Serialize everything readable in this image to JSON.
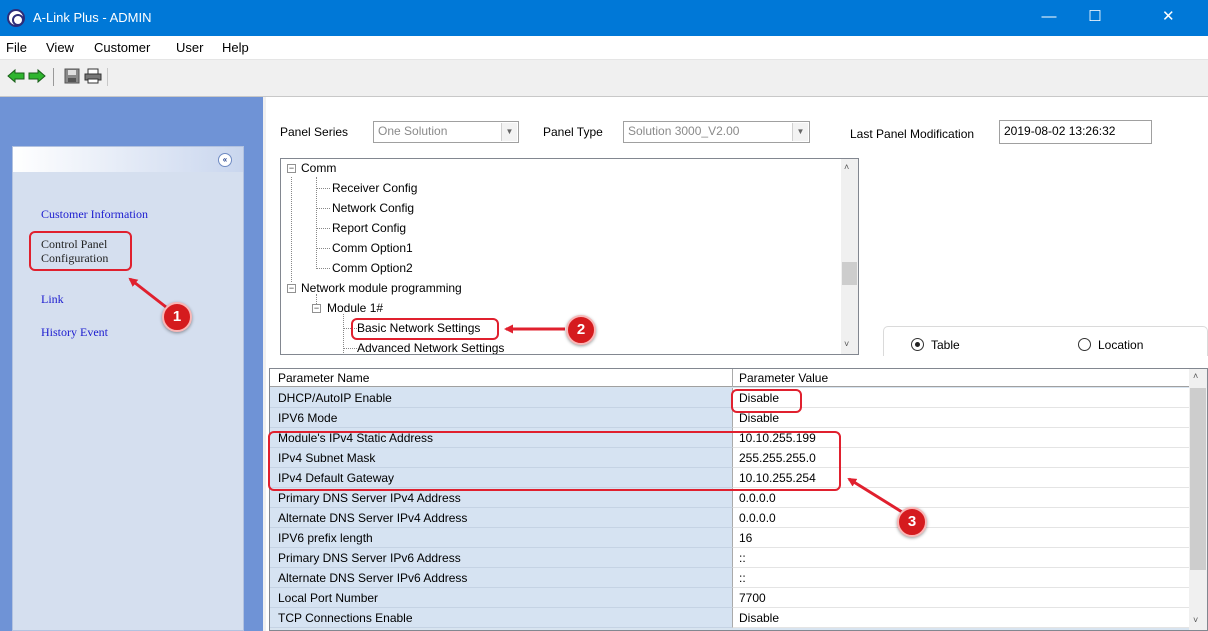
{
  "window": {
    "title": "A-Link Plus - ADMIN",
    "minimize": "—",
    "maximize": "☐",
    "close": "✕"
  },
  "menu": [
    "File",
    "View",
    "Customer",
    "User",
    "Help"
  ],
  "toolbar": {
    "icons": [
      "back-arrow-icon",
      "forward-arrow-icon",
      "save-icon",
      "print-icon"
    ]
  },
  "sidebar": {
    "collapse_icon": "«",
    "items": [
      {
        "label": "Customer Information"
      },
      {
        "label_line1": "Control Panel",
        "label_line2": "Configuration"
      },
      {
        "label": "Link"
      },
      {
        "label": "History Event"
      }
    ]
  },
  "panel": {
    "series_label": "Panel Series",
    "series_value": "One Solution",
    "type_label": "Panel Type",
    "type_value": "Solution 3000_V2.00",
    "last_mod_label": "Last Panel Modification",
    "last_mod_value": "2019-08-02 13:26:32"
  },
  "tree": {
    "comm": "Comm",
    "receiver": "Receiver Config",
    "network": "Network Config",
    "report": "Report Config",
    "opt1": "Comm Option1",
    "opt2": "Comm Option2",
    "netmod": "Network module programming",
    "module": "Module 1#",
    "basic": "Basic Network Settings",
    "advanced": "Advanced  Network Settings"
  },
  "view_toggle": {
    "table": "Table",
    "location": "Location",
    "selected": "Table"
  },
  "grid": {
    "header_name": "Parameter Name",
    "header_value": "Parameter Value",
    "rows": [
      {
        "name": "DHCP/AutoIP Enable",
        "value": "Disable"
      },
      {
        "name": "IPV6 Mode",
        "value": "Disable"
      },
      {
        "name": "Module's IPv4 Static Address",
        "value": "10.10.255.199"
      },
      {
        "name": "IPv4 Subnet Mask",
        "value": "255.255.255.0"
      },
      {
        "name": "IPv4 Default Gateway",
        "value": "10.10.255.254"
      },
      {
        "name": "Primary DNS Server IPv4 Address",
        "value": "0.0.0.0"
      },
      {
        "name": "Alternate DNS Server IPv4 Address",
        "value": "0.0.0.0"
      },
      {
        "name": "IPV6 prefix length",
        "value": "16"
      },
      {
        "name": "Primary DNS Server IPv6 Address",
        "value": "::"
      },
      {
        "name": "Alternate DNS Server IPv6 Address",
        "value": "::"
      },
      {
        "name": "Local Port Number",
        "value": "7700"
      },
      {
        "name": "TCP Connections Enable",
        "value": "Disable"
      }
    ]
  },
  "annotations": {
    "badge1": "1",
    "badge2": "2",
    "badge3": "3",
    "color": "#e0202e"
  }
}
